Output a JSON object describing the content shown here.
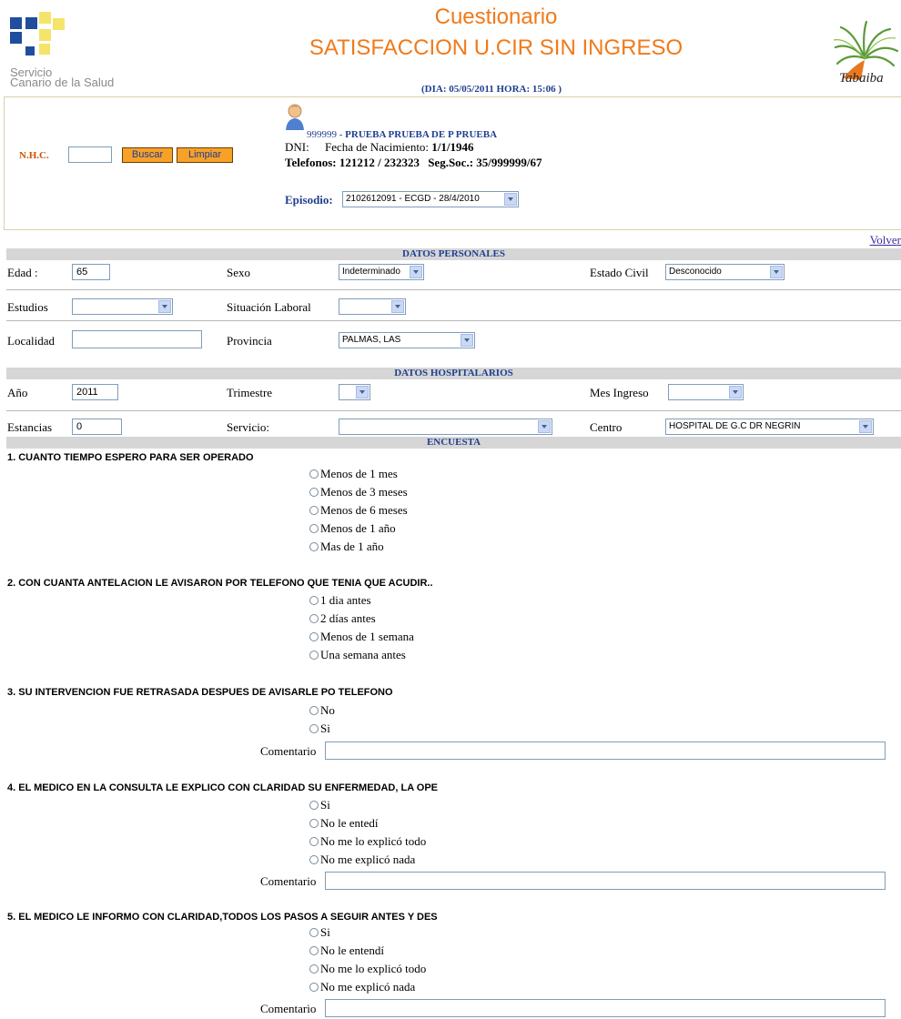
{
  "header": {
    "logo_text_line1": "Servicio",
    "logo_text_line2": "Canario de la Salud",
    "title_line1": "Cuestionario",
    "title_line2": "SATISFACCION U.CIR SIN INGRESO",
    "datetime": "(DIA: 05/05/2011 HORA: 15:06 )",
    "right_logo_text": "Tabaiba",
    "colors": {
      "title": "#f07a1a",
      "logo_blue": "#1f4e9e",
      "logo_yellow": "#f5e46a",
      "link": "#1f3f8f"
    }
  },
  "patient": {
    "nhc_label": "N.H.C.",
    "nhc_value": "",
    "search_label": "Buscar",
    "clear_label": "Limpiar",
    "id": "999999",
    "separator": " - ",
    "name": "PRUEBA PRUEBA DE P PRUEBA",
    "dni_label": "DNI:",
    "birth_label": "Fecha de Nacimiento:",
    "birth_value": "1/1/1946",
    "phones_label": "Telefonos:",
    "phones_value": "121212 / 232323",
    "ss_label": "Seg.Soc.:",
    "ss_value": "35/999999/67",
    "episode_label": "Episodio:",
    "episode_value": "2102612091 - ECGD - 28/4/2010"
  },
  "volver": "Volver",
  "personal": {
    "section": "DATOS PERSONALES",
    "edad_label": "Edad :",
    "edad_value": "65",
    "sexo_label": "Sexo",
    "sexo_value": "Indeterminado",
    "estado_civil_label": "Estado Civil",
    "estado_civil_value": "Desconocido",
    "estudios_label": "Estudios",
    "estudios_value": "",
    "situacion_label": "Situación Laboral",
    "situacion_value": "",
    "localidad_label": "Localidad",
    "localidad_value": "",
    "provincia_label": "Provincia",
    "provincia_value": "PALMAS, LAS"
  },
  "hospital": {
    "section": "DATOS HOSPITALARIOS",
    "anio_label": "Año",
    "anio_value": "2011",
    "trimestre_label": "Trimestre",
    "trimestre_value": "",
    "mes_label": "Mes Ingreso",
    "mes_value": "",
    "estancias_label": "Estancias",
    "estancias_value": "0",
    "servicio_label": "Servicio:",
    "servicio_value": "",
    "centro_label": "Centro",
    "centro_value": "HOSPITAL DE G.C DR NEGRIN"
  },
  "survey": {
    "section": "ENCUESTA",
    "comment_label": "Comentario",
    "questions": [
      {
        "title": "1. CUANTO TIEMPO ESPERO PARA SER OPERADO",
        "options": [
          "Menos de 1 mes",
          "Menos de 3 meses",
          "Menos de 6 meses",
          "Menos de 1 año",
          "Mas de 1 año"
        ]
      },
      {
        "title": "2. CON CUANTA ANTELACION LE AVISARON POR TELEFONO QUE TENIA QUE ACUDIR..",
        "options": [
          "1 dia antes",
          "2 días antes",
          "Menos de 1 semana",
          "Una semana antes"
        ]
      },
      {
        "title": "3. SU INTERVENCION FUE RETRASADA DESPUES DE AVISARLE PO TELEFONO",
        "options": [
          "No",
          "Si"
        ]
      },
      {
        "title": "4. EL MEDICO EN LA CONSULTA LE EXPLICO CON CLARIDAD SU ENFERMEDAD, LA OPE",
        "options": [
          "Si",
          "No le entedí",
          "No me lo explicó todo",
          "No me explicó nada"
        ]
      },
      {
        "title": "5. EL MEDICO LE INFORMO CON CLARIDAD,TODOS LOS PASOS A SEGUIR ANTES Y DES",
        "options": [
          "Si",
          "No le entendí",
          "No me lo explicó todo",
          "No me explicó nada"
        ]
      }
    ]
  }
}
